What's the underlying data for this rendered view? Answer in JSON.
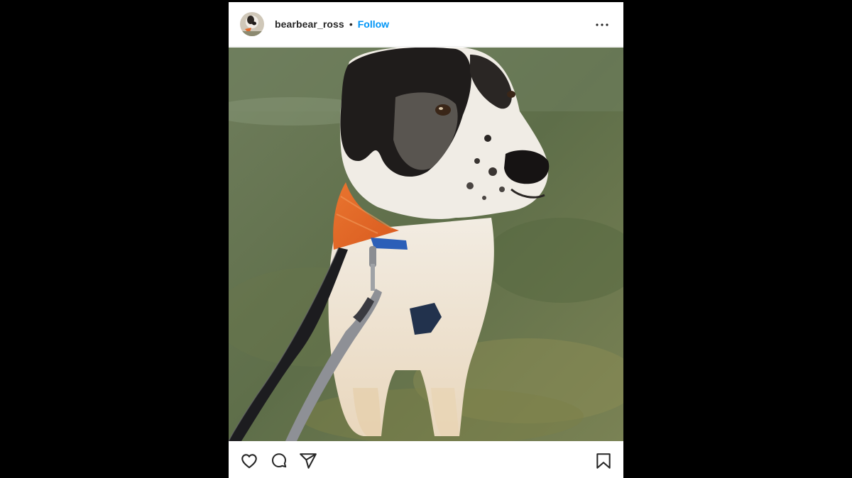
{
  "post": {
    "username": "bearbear_ross",
    "separator": "•",
    "follow_label": "Follow"
  },
  "colors": {
    "follow_blue": "#0095f6",
    "text": "#262626",
    "background": "#000000"
  },
  "icons": {
    "more": "more-options-icon",
    "like": "heart-icon",
    "comment": "comment-icon",
    "share": "paper-plane-icon",
    "save": "bookmark-icon"
  }
}
